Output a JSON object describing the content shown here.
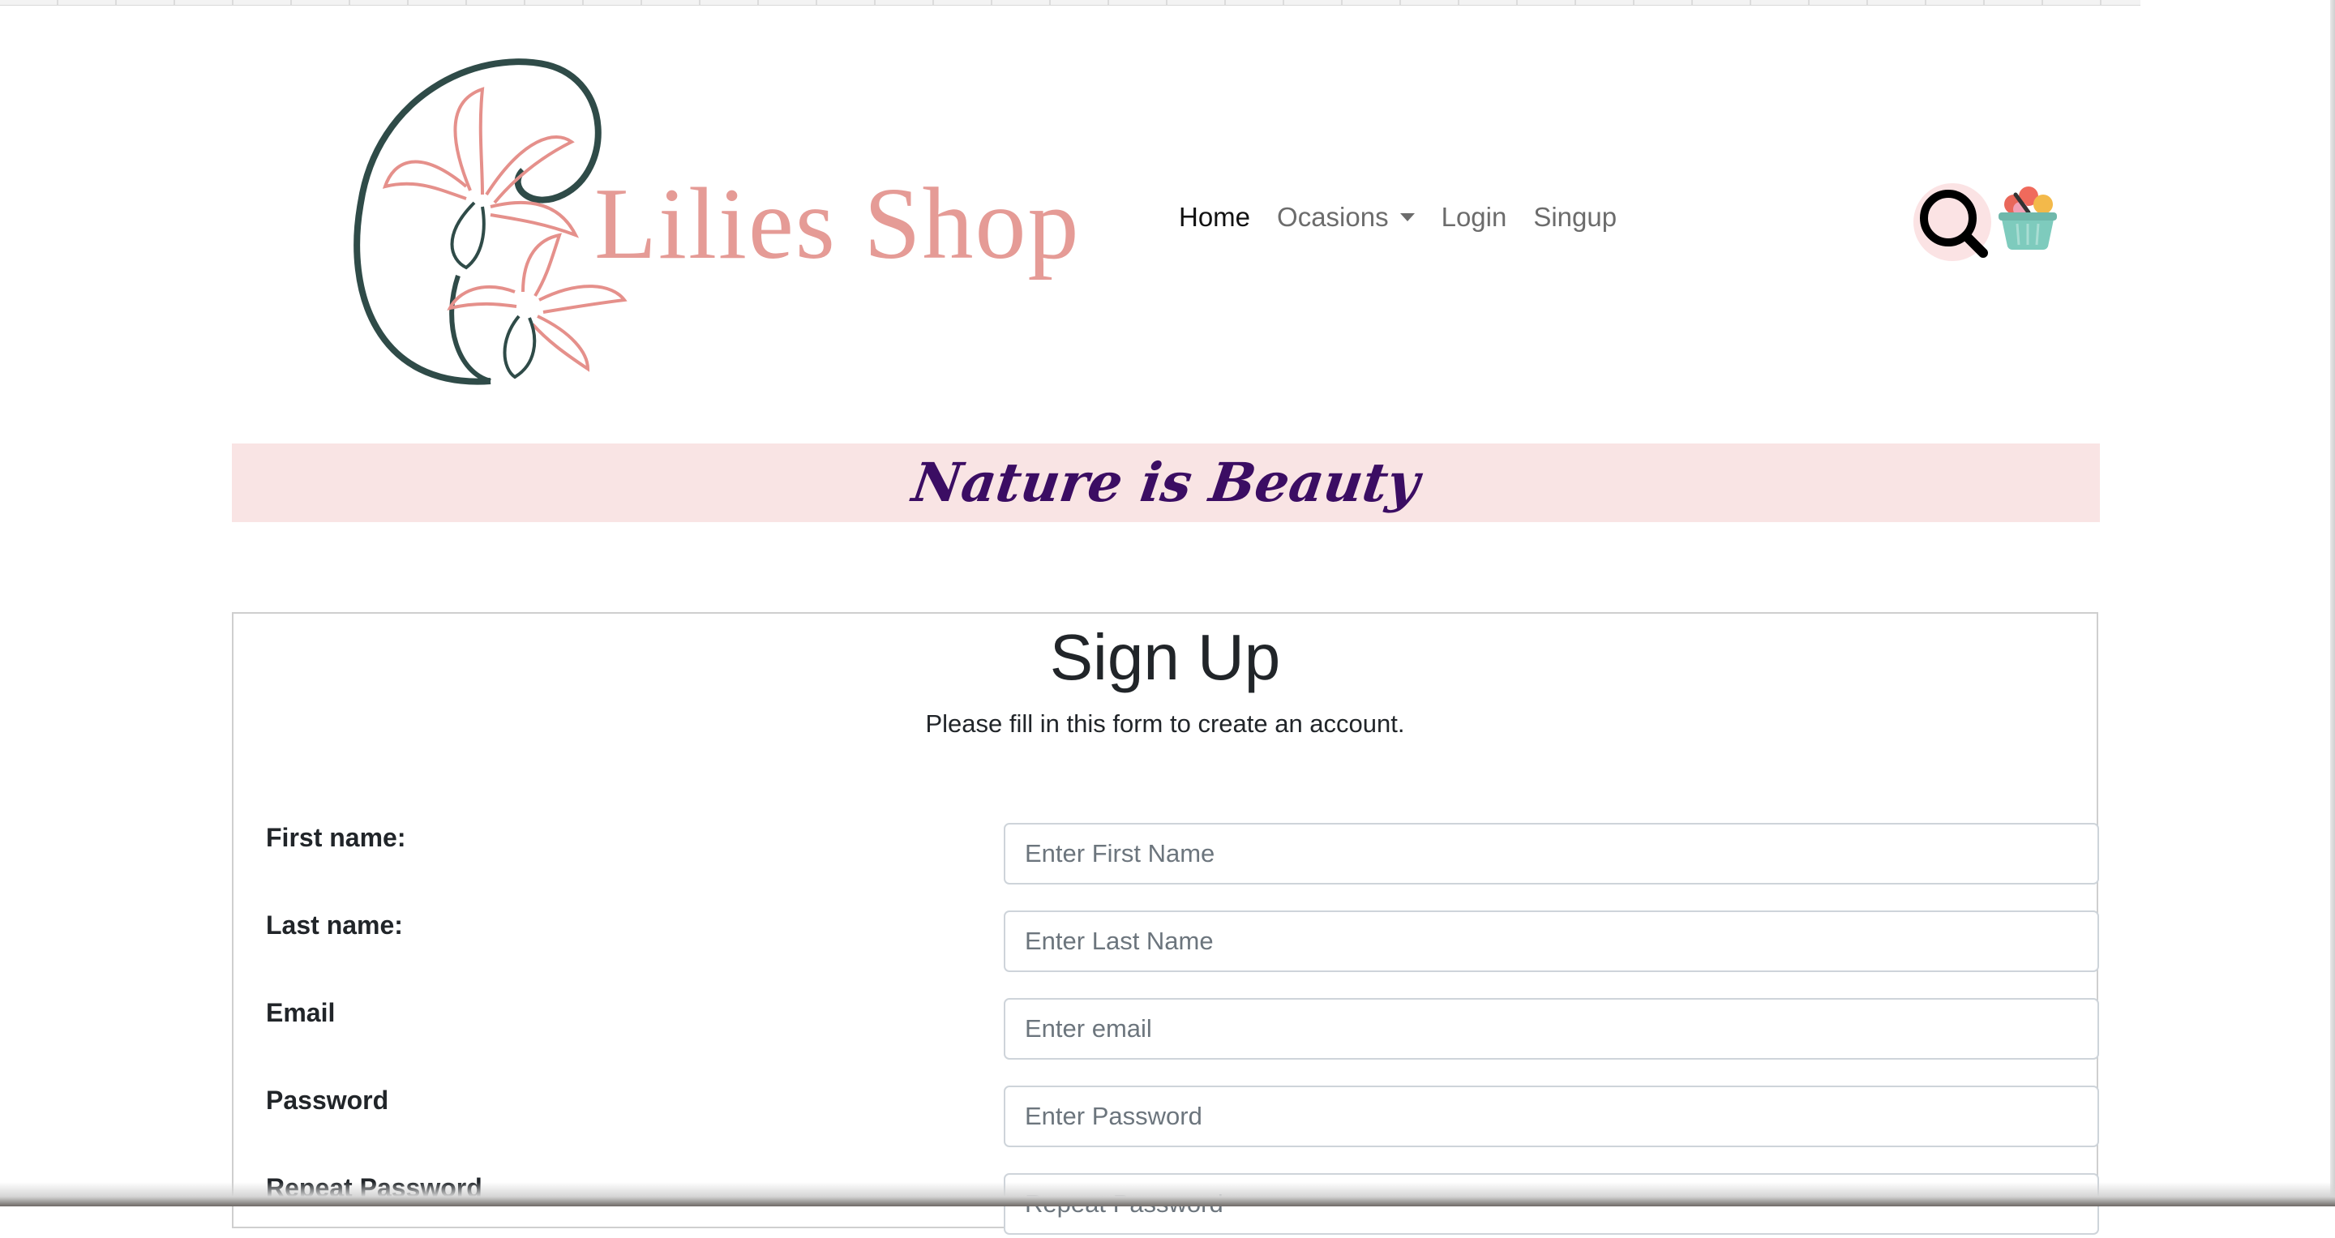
{
  "brand": {
    "name": "Lilies Shop"
  },
  "nav": {
    "items": [
      {
        "label": "Home"
      },
      {
        "label": "Ocasions"
      },
      {
        "label": "Login"
      },
      {
        "label": "Singup"
      }
    ]
  },
  "icons": {
    "search": "search-icon",
    "cart": "flower-basket-icon"
  },
  "banner": {
    "text": "Nature is Beauty"
  },
  "form": {
    "title": "Sign Up",
    "subtitle": "Please fill in this form to create an account.",
    "fields": [
      {
        "label": "First name:",
        "placeholder": "Enter First Name"
      },
      {
        "label": "Last name:",
        "placeholder": "Enter Last Name"
      },
      {
        "label": "Email",
        "placeholder": "Enter email"
      },
      {
        "label": "Password",
        "placeholder": "Enter Password"
      },
      {
        "label": "Repeat Password",
        "placeholder": "Repeat Password"
      }
    ]
  },
  "colors": {
    "logo_pink": "#e59b96",
    "logo_dark": "#2f4b48",
    "banner_bg": "#f9e4e4",
    "banner_text": "#3b0d63",
    "search_bg": "#fbe3e4"
  }
}
